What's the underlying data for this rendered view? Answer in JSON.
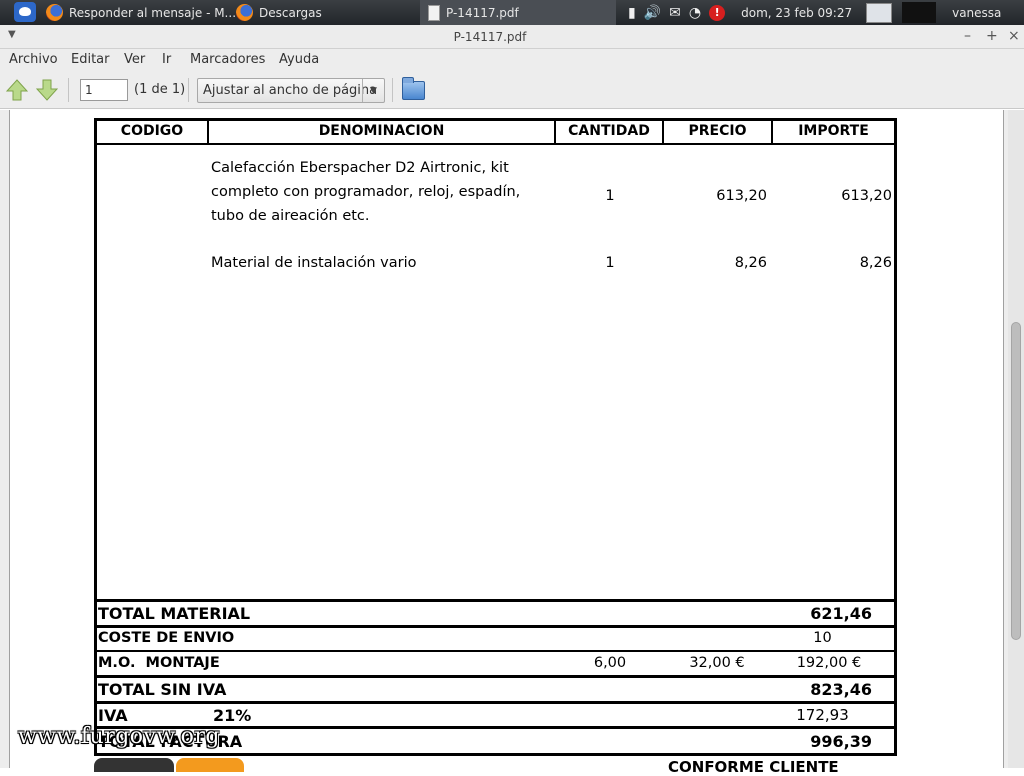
{
  "panel": {
    "tasks": [
      {
        "label": "Responder al mensaje - M...",
        "icon": "firefox-icon"
      },
      {
        "label": "Descargas",
        "icon": "firefox-icon"
      },
      {
        "label": "P-14117.pdf",
        "icon": "document-icon"
      }
    ],
    "alert_badge": "!",
    "clock": "dom, 23 feb  09:27",
    "user": "vanessa"
  },
  "window": {
    "title": "P-14117.pdf"
  },
  "menubar": {
    "items": [
      "Archivo",
      "Editar",
      "Ver",
      "Ir",
      "Marcadores",
      "Ayuda"
    ]
  },
  "toolbar": {
    "page_value": "1",
    "page_count": "(1 de 1)",
    "zoom_label": "Ajustar al ancho de página"
  },
  "invoice": {
    "headers": {
      "codigo": "CODIGO",
      "denominacion": "DENOMINACION",
      "cantidad": "CANTIDAD",
      "precio": "PRECIO",
      "importe": "IMPORTE"
    },
    "items": [
      {
        "denominacion_lines": [
          "Calefacción Eberspacher D2 Airtronic, kit",
          "completo con programador, reloj, espadín,",
          "tubo de aireación etc."
        ],
        "cantidad": "1",
        "precio": "613,20",
        "importe": "613,20"
      },
      {
        "denominacion_lines": [
          "Material de instalación vario"
        ],
        "cantidad": "1",
        "precio": "8,26",
        "importe": "8,26"
      }
    ],
    "total_material": {
      "label": "TOTAL MATERIAL",
      "value": "621,46"
    },
    "coste_envio": {
      "label": "COSTE DE ENVIO",
      "value": "10"
    },
    "montaje": {
      "label": "M.O.  MONTAJE",
      "hours": "6,00",
      "rate": "32,00 €",
      "value": "192,00 €"
    },
    "total_sin_iva": {
      "label": "TOTAL SIN IVA",
      "value": "823,46"
    },
    "iva": {
      "label": "IVA",
      "rate": "21%",
      "value": "172,93"
    },
    "total": {
      "label": "TOTAL FACTURA",
      "value": "996,39"
    },
    "conforme": "CONFORME CLIENTE"
  },
  "watermark": "www.furgovw.org"
}
